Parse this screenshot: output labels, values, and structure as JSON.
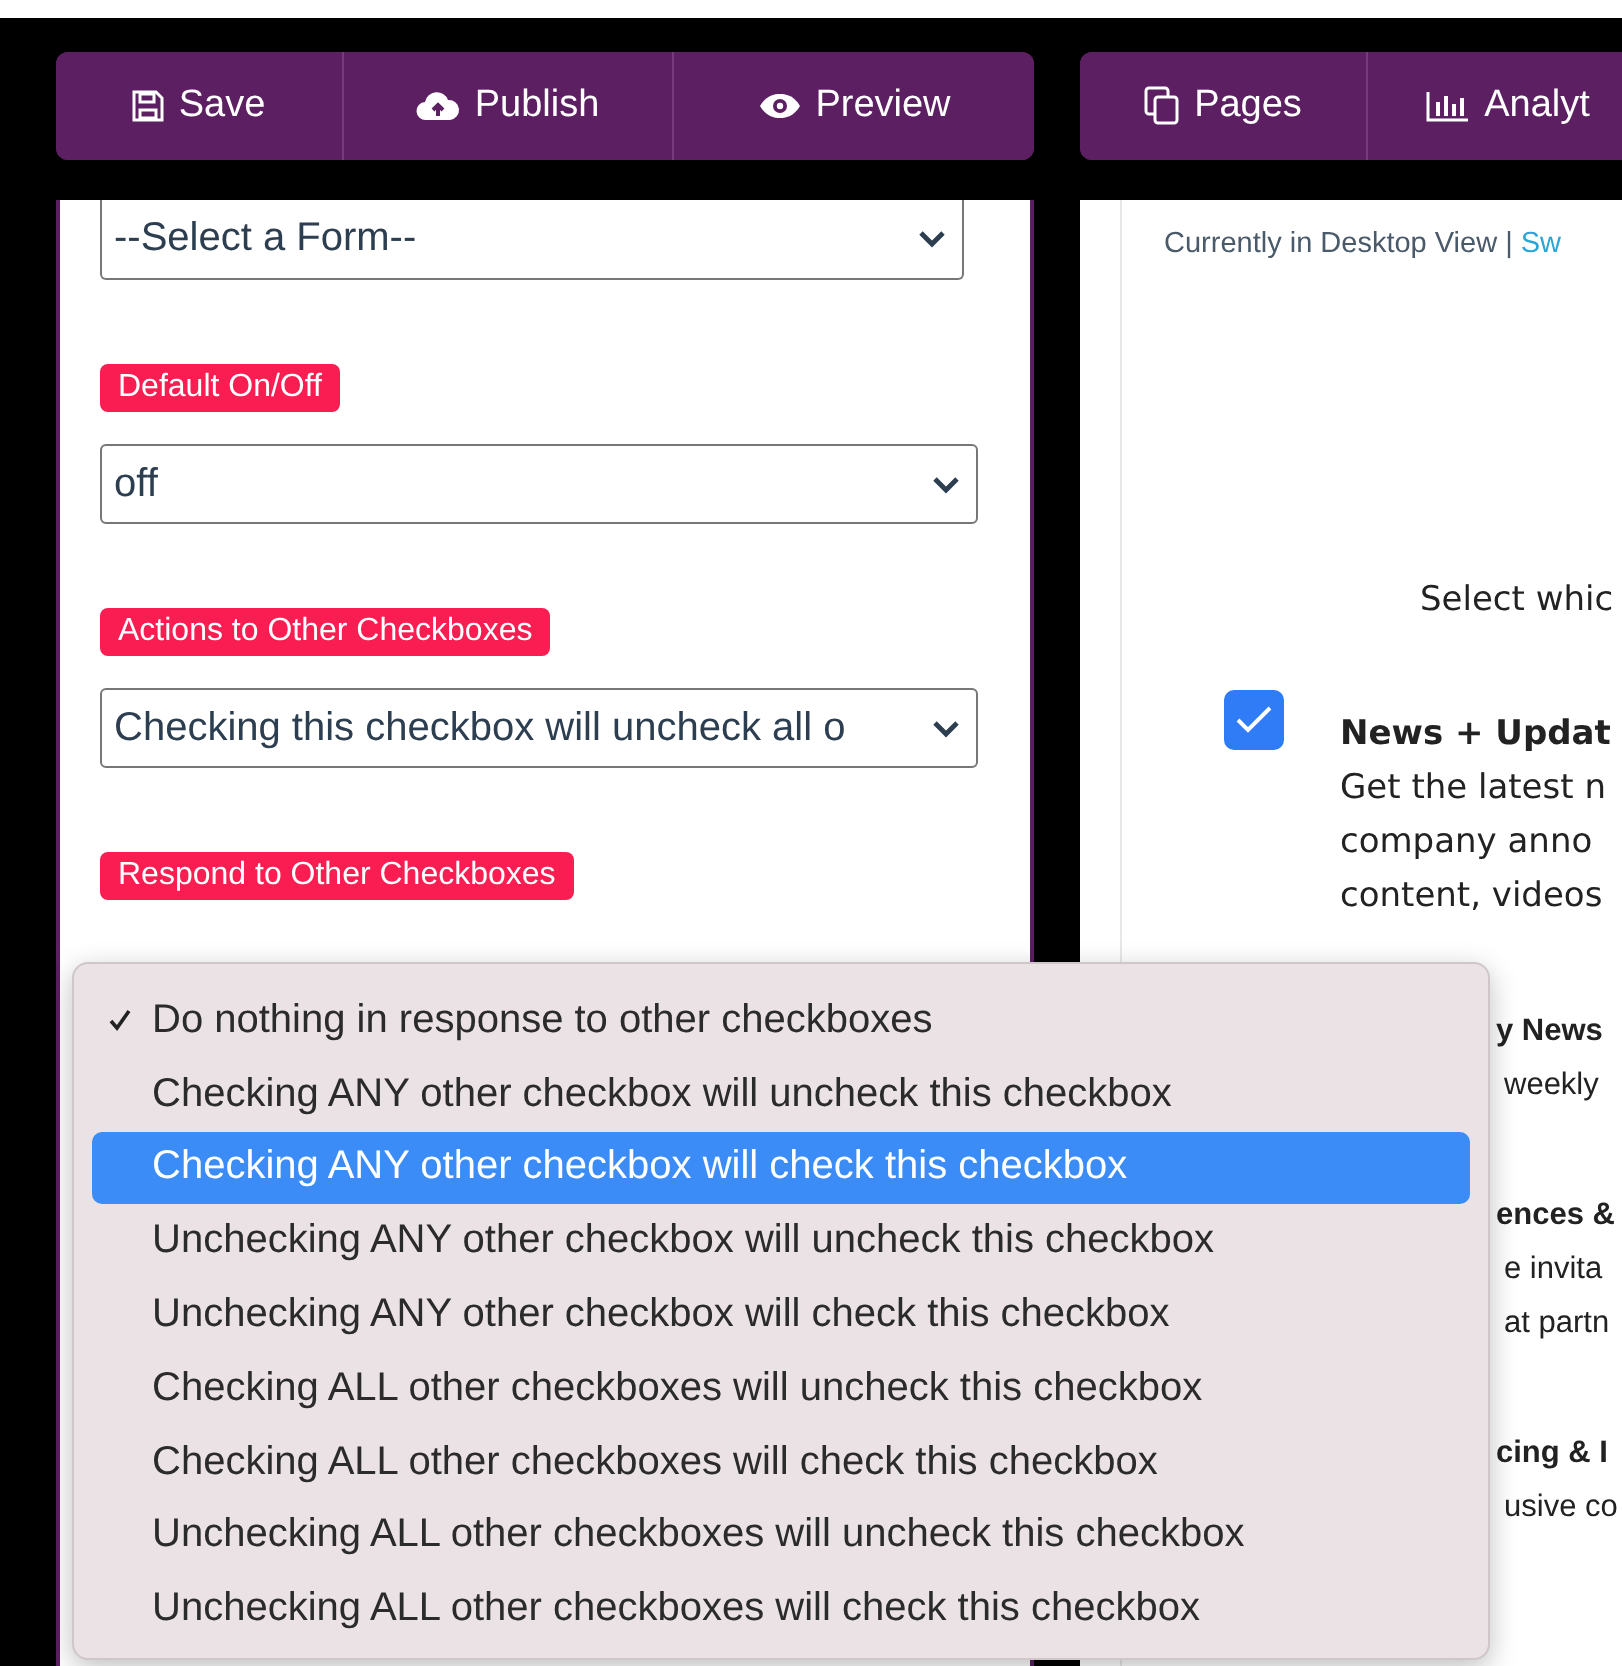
{
  "toolbar_left": [
    {
      "label": "Save"
    },
    {
      "label": "Publish"
    },
    {
      "label": "Preview"
    }
  ],
  "toolbar_right": [
    {
      "label": "Pages"
    },
    {
      "label": "Analyt"
    }
  ],
  "form_select": {
    "value": "--Select a Form--"
  },
  "settings": [
    {
      "label": "Default On/Off",
      "value": "off"
    },
    {
      "label": "Actions to Other Checkboxes",
      "value": "Checking this checkbox will uncheck all o"
    },
    {
      "label": "Respond to Other Checkboxes"
    }
  ],
  "preview": {
    "view_text": "Currently in Desktop View |",
    "switch_link": "Sw",
    "prompt": "Select whic",
    "options": [
      {
        "title": "News + Updat",
        "lines": [
          "Get the latest n",
          "company anno",
          "content, videos"
        ],
        "checked": true
      },
      {
        "title": "y News",
        "lines": [
          "weekly"
        ]
      },
      {
        "title": "ences &",
        "lines": [
          "e invita",
          "at partn"
        ]
      },
      {
        "title": "cing & I",
        "lines": [
          "usive co"
        ]
      }
    ]
  },
  "menu": [
    {
      "label": "Do nothing in response to other checkboxes",
      "checked": true,
      "selected": false
    },
    {
      "label": "Checking ANY other checkbox will uncheck this checkbox",
      "checked": false,
      "selected": false
    },
    {
      "label": "Checking ANY other checkbox will check this checkbox",
      "checked": false,
      "selected": true
    },
    {
      "label": "Unchecking ANY other checkbox will uncheck this checkbox",
      "checked": false,
      "selected": false
    },
    {
      "label": "Unchecking ANY other checkbox will check this checkbox",
      "checked": false,
      "selected": false
    },
    {
      "label": "Checking ALL other checkboxes will uncheck this checkbox",
      "checked": false,
      "selected": false
    },
    {
      "label": "Checking ALL other checkboxes will check this checkbox",
      "checked": false,
      "selected": false
    },
    {
      "label": "Unchecking ALL other checkboxes will uncheck this checkbox",
      "checked": false,
      "selected": false
    },
    {
      "label": "Unchecking ALL other checkboxes will check this checkbox",
      "checked": false,
      "selected": false
    }
  ]
}
